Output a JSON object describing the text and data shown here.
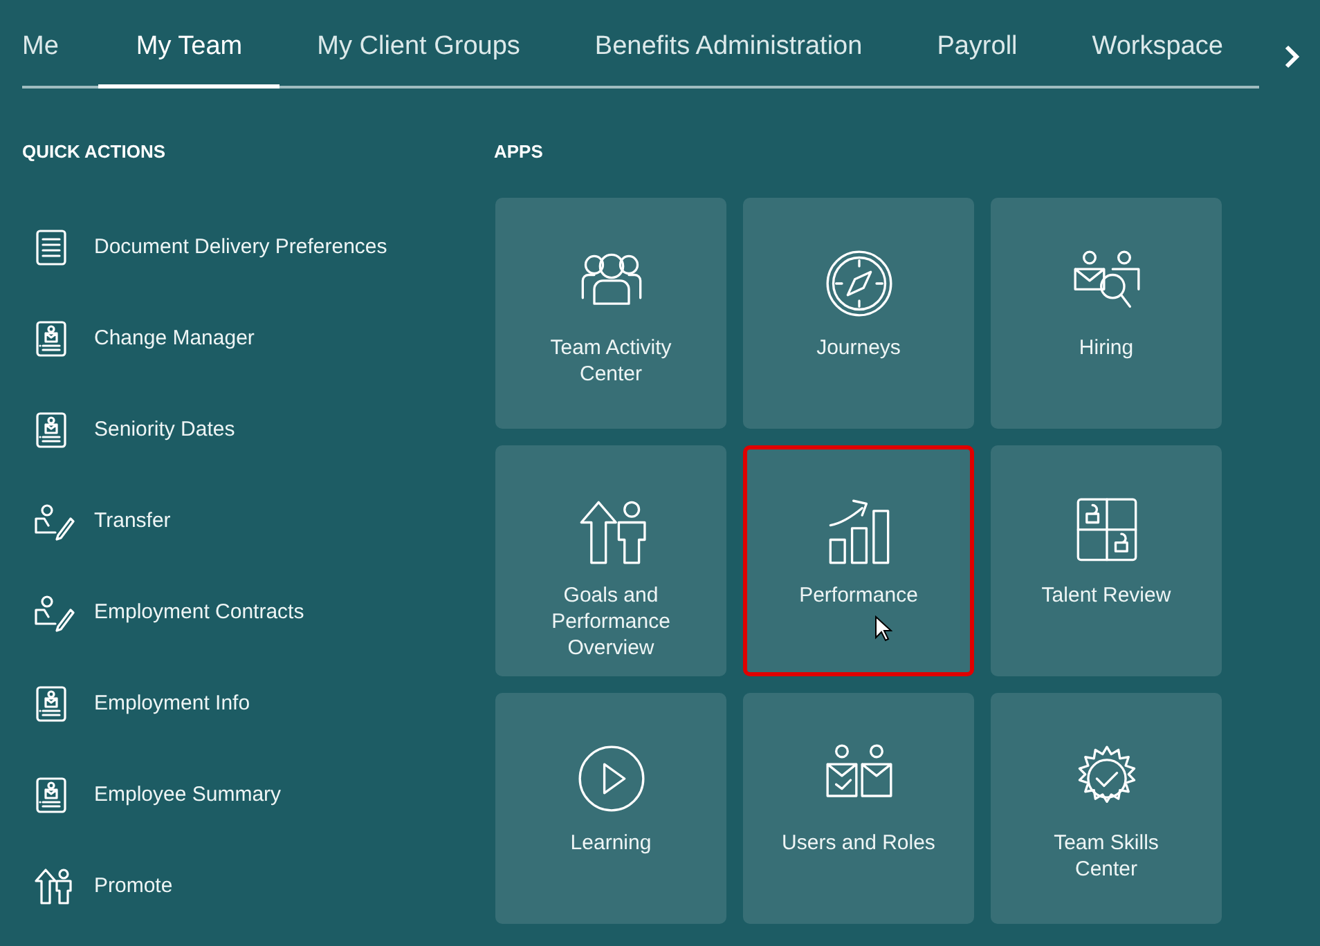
{
  "tabs": [
    {
      "label": "Me",
      "selected": false
    },
    {
      "label": "My Team",
      "selected": true
    },
    {
      "label": "My Client Groups",
      "selected": false
    },
    {
      "label": "Benefits Administration",
      "selected": false
    },
    {
      "label": "Payroll",
      "selected": false
    },
    {
      "label": "Workspace",
      "selected": false
    }
  ],
  "quick_actions": {
    "heading": "QUICK ACTIONS",
    "items": [
      {
        "label": "Document Delivery Preferences",
        "kind": "document"
      },
      {
        "label": "Change Manager",
        "kind": "badge"
      },
      {
        "label": "Seniority Dates",
        "kind": "badge"
      },
      {
        "label": "Transfer",
        "kind": "edit"
      },
      {
        "label": "Employment Contracts",
        "kind": "edit"
      },
      {
        "label": "Employment Info",
        "kind": "badge"
      },
      {
        "label": "Employee Summary",
        "kind": "badge"
      },
      {
        "label": "Promote",
        "kind": "promote"
      }
    ]
  },
  "apps": {
    "heading": "APPS",
    "tiles": [
      {
        "label": "Team Activity Center",
        "kind": "team",
        "highlighted": false
      },
      {
        "label": "Journeys",
        "kind": "compass",
        "highlighted": false
      },
      {
        "label": "Hiring",
        "kind": "hiring",
        "highlighted": false
      },
      {
        "label": "Goals and Performance Overview",
        "kind": "promote",
        "highlighted": false
      },
      {
        "label": "Performance",
        "kind": "chart",
        "highlighted": true
      },
      {
        "label": "Talent Review",
        "kind": "talent",
        "highlighted": false
      },
      {
        "label": "Learning",
        "kind": "play",
        "highlighted": false
      },
      {
        "label": "Users and Roles",
        "kind": "users",
        "highlighted": false
      },
      {
        "label": "Team Skills Center",
        "kind": "award",
        "highlighted": false
      }
    ]
  }
}
